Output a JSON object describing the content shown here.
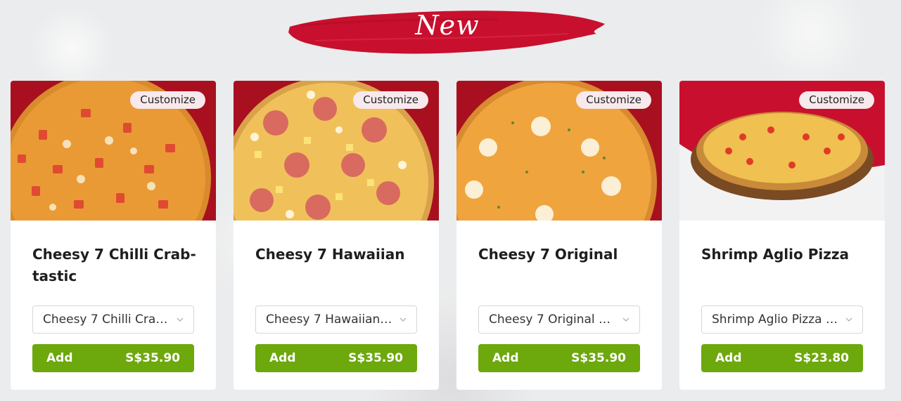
{
  "banner": {
    "text": "New",
    "color": "#c8102e"
  },
  "colors": {
    "add_button": "#6da80c",
    "customize_badge": "#f7e9ec",
    "card_bg": "#ffffff"
  },
  "products": [
    {
      "name": "Cheesy 7 Chilli Crab-tastic",
      "customize_label": "Customize",
      "option": "Cheesy 7 Chilli Crab…",
      "add_label": "Add",
      "price": "S$35.90",
      "image": "pizza-chilli-crab"
    },
    {
      "name": "Cheesy 7 Hawaiian",
      "customize_label": "Customize",
      "option": "Cheesy 7 Hawaiian …",
      "add_label": "Add",
      "price": "S$35.90",
      "image": "pizza-hawaiian"
    },
    {
      "name": "Cheesy 7 Original",
      "customize_label": "Customize",
      "option": "Cheesy 7 Original Pi…",
      "add_label": "Add",
      "price": "S$35.90",
      "image": "pizza-original"
    },
    {
      "name": "Shrimp Aglio Pizza",
      "customize_label": "Customize",
      "option": "Shrimp Aglio Pizza R…",
      "add_label": "Add",
      "price": "S$23.80",
      "image": "pizza-shrimp-aglio"
    }
  ]
}
